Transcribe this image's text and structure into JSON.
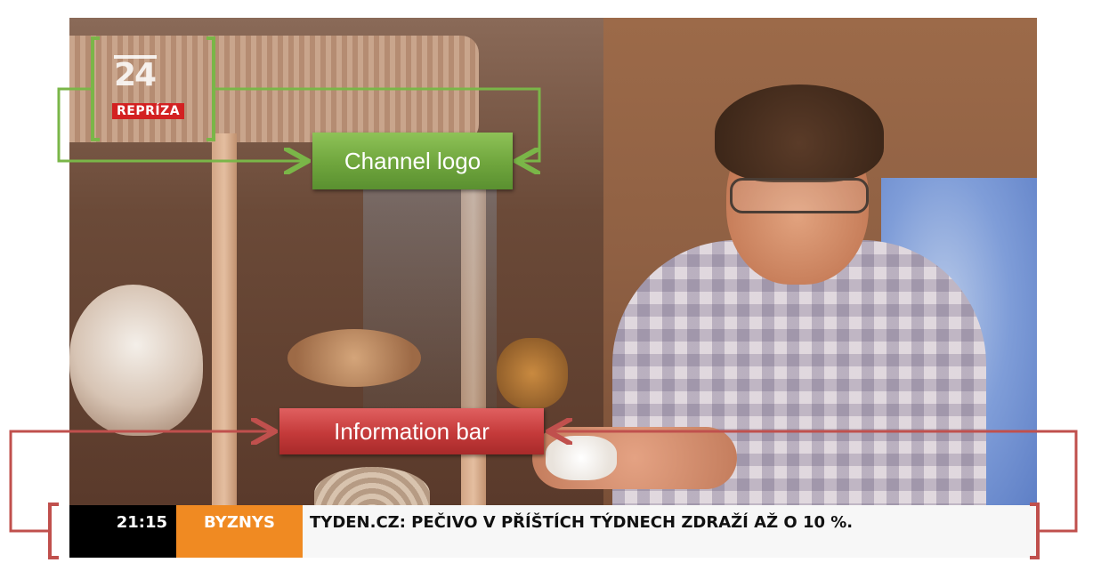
{
  "channel": {
    "number": "24",
    "tag": "REPRÍZA"
  },
  "ticker": {
    "time": "21:15",
    "category": "BYZNYS",
    "headline": "TYDEN.CZ: PEČIVO V PŘÍŠTÍCH TÝDNECH ZDRAŽÍ AŽ O 10 %."
  },
  "annotations": {
    "channel_logo_label": "Channel logo",
    "information_bar_label": "Information bar"
  },
  "colors": {
    "logo_tag": "#d32121",
    "category_bg": "#f08a22",
    "time_bg": "#000000",
    "headline_bg": "#f7f7f7",
    "annotation_green": "#7ab648",
    "annotation_red": "#c0504d"
  }
}
